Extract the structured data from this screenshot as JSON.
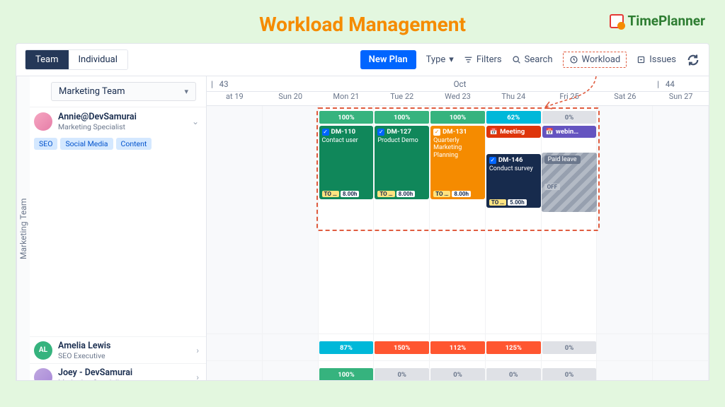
{
  "page_title": "Workload Management",
  "brand": "TimePlanner",
  "toolbar": {
    "tab_team": "Team",
    "tab_individual": "Individual",
    "new_plan": "New Plan",
    "type": "Type",
    "filters": "Filters",
    "search": "Search",
    "workload": "Workload",
    "issues": "Issues"
  },
  "team_select": "Marketing Team",
  "side_label": "Marketing Team",
  "weeks": {
    "w43": "43",
    "month": "Oct",
    "w44": "44"
  },
  "days": [
    "at 19",
    "Sun 20",
    "Mon 21",
    "Tue 22",
    "Wed 23",
    "Thu 24",
    "Fri 25",
    "Sat 26",
    "Sun 27"
  ],
  "people": [
    {
      "name": "Annie@DevSamurai",
      "role": "Marketing Specialist",
      "avatar_bg": "linear-gradient(135deg,#f6a6c1,#e67ea8)",
      "tags": [
        "SEO",
        "Social Media",
        "Content"
      ],
      "workload": [
        null,
        null,
        "100%",
        "100%",
        "100%",
        "62%",
        "0%",
        null,
        null
      ],
      "workload_class": [
        null,
        null,
        "g",
        "g",
        "g",
        "b",
        "gr",
        null,
        null
      ],
      "cards_row1": [
        null,
        null,
        {
          "c": "c-green",
          "id": "DM-110",
          "t": "Contact user",
          "h": "8.00h",
          "s": "TO …",
          "ck": "b"
        },
        {
          "c": "c-green",
          "id": "DM-127",
          "t": "Product Demo",
          "h": "8.00h",
          "s": "TO …",
          "ck": "b"
        },
        {
          "c": "c-orange",
          "id": "DM-131",
          "t": "Quarterly Marketing Planning",
          "h": "8.00h",
          "s": "TO …",
          "ck": "o"
        },
        {
          "c": "c-red",
          "t": "Meeting",
          "icon": "cal"
        },
        {
          "c": "c-purple",
          "t": "webin…",
          "icon": "cal"
        },
        null,
        null
      ],
      "cards_row2": [
        null,
        null,
        null,
        null,
        null,
        {
          "c": "c-navy",
          "id": "DM-146",
          "t": "Conduct survey",
          "h": "5.00h",
          "s": "TO …",
          "ck": "b"
        },
        {
          "c": "stripes",
          "paid": "Paid leave",
          "off": "OFF"
        },
        null,
        null
      ]
    },
    {
      "name": "Amelia Lewis",
      "role": "SEO Executive",
      "initials": "AL",
      "avatar_bg": "#36b37e",
      "workload": [
        null,
        null,
        "87%",
        "150%",
        "112%",
        "125%",
        "0%",
        null,
        null
      ],
      "workload_class": [
        null,
        null,
        "b",
        "r",
        "r",
        "r",
        "gr",
        null,
        null
      ]
    },
    {
      "name": "Joey - DevSamurai",
      "role": "Marketing Specialist",
      "avatar_bg": "linear-gradient(135deg,#c0a8e0,#a888d8)",
      "workload": [
        null,
        null,
        "100%",
        "0%",
        "0%",
        "0%",
        "0%",
        null,
        null
      ],
      "workload_class": [
        null,
        null,
        "g",
        "gr",
        "gr",
        "gr",
        "gr",
        null,
        null
      ]
    }
  ]
}
